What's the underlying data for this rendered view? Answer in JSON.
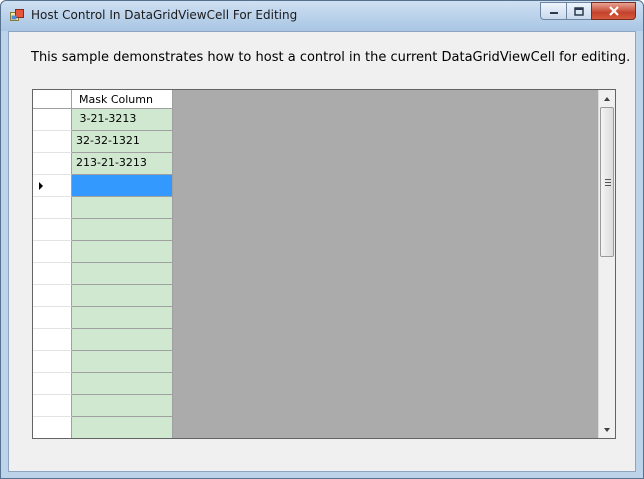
{
  "window": {
    "title": "Host Control In DataGridViewCell For Editing",
    "icons": {
      "app": "app-window-icon",
      "minimize": "minimize-icon",
      "maximize": "maximize-icon",
      "close": "close-icon"
    }
  },
  "description": "This sample demonstrates how to host a control in the current DataGridViewCell  for editing.",
  "grid": {
    "column_header": "Mask Column",
    "rows": [
      {
        "value": " 3-21-3213"
      },
      {
        "value": "32-32-1321"
      },
      {
        "value": "213-21-3213"
      },
      {
        "value": "",
        "current": true
      },
      {
        "value": ""
      },
      {
        "value": ""
      },
      {
        "value": ""
      },
      {
        "value": ""
      },
      {
        "value": ""
      },
      {
        "value": ""
      },
      {
        "value": ""
      },
      {
        "value": ""
      },
      {
        "value": ""
      },
      {
        "value": ""
      },
      {
        "value": ""
      }
    ],
    "current_row_indicator": "row-arrow-icon",
    "colors": {
      "cell_background": "#d0e8d0",
      "selected_cell": "#3399ff",
      "grid_background": "#ababab"
    }
  }
}
